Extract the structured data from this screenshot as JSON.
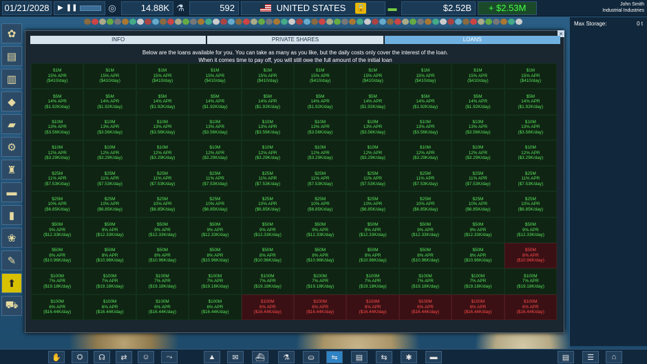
{
  "topbar": {
    "date": "01/21/2028",
    "population": "14.88K",
    "research": "592",
    "country": "UNITED STATES",
    "money": "$2.52B",
    "income": "+ $2.53M",
    "user_name": "John Smith",
    "company": "Industrial Industries"
  },
  "right_panel": {
    "label": "Max Storage:",
    "value": "0 t"
  },
  "modal": {
    "tabs": [
      {
        "label": "INFO",
        "active": false
      },
      {
        "label": "PRIVATE SHARES",
        "active": false
      },
      {
        "label": "LOANS",
        "active": true
      }
    ],
    "intro_line1": "Below are the loans available for you. You can take as many as you like, but the daily costs only cover the interest of the loan.",
    "intro_line2": "When it comes time to pay off, you will still owe the full amount of the initial loan",
    "close_label": "×"
  },
  "loan_rows": [
    {
      "amount": "$1M",
      "apr": "15% APR",
      "daily": "($410/day)",
      "unavailable_from": 10
    },
    {
      "amount": "$5M",
      "apr": "14% APR",
      "daily": "($1.92K/day)",
      "unavailable_from": 10
    },
    {
      "amount": "$10M",
      "apr": "13% APR",
      "daily": "($3.56K/day)",
      "unavailable_from": 10
    },
    {
      "amount": "$10M",
      "apr": "12% APR",
      "daily": "($3.29K/day)",
      "unavailable_from": 10
    },
    {
      "amount": "$25M",
      "apr": "11% APR",
      "daily": "($7.53K/day)",
      "unavailable_from": 10
    },
    {
      "amount": "$25M",
      "apr": "10% APR",
      "daily": "($6.85K/day)",
      "unavailable_from": 10
    },
    {
      "amount": "$50M",
      "apr": "9% APR",
      "daily": "($12.33K/day)",
      "unavailable_from": 10
    },
    {
      "amount": "$50M",
      "apr": "8% APR",
      "daily": "($10.96K/day)",
      "unavailable_from": 9
    },
    {
      "amount": "$100M",
      "apr": "7% APR",
      "daily": "($19.18K/day)",
      "unavailable_from": 10
    },
    {
      "amount": "$100M",
      "apr": "6% APR",
      "daily": "($16.44K/day)",
      "unavailable_from": 4
    }
  ],
  "sidebar_icons": [
    "farm-icon",
    "factory-icon",
    "warehouse-icon",
    "mine-icon",
    "oil-icon",
    "gears-icon",
    "tower-icon",
    "truck-icon",
    "silo-icon",
    "crops-icon",
    "dropper-icon",
    "upgrade-arrow-icon",
    "bulldozer-icon"
  ],
  "bottombar_icons": [
    "vote-icon",
    "bank-icon",
    "megaphone-icon",
    "trade-icon",
    "astronaut-icon",
    "route-icon",
    "people-icon",
    "chat-icon",
    "ship-icon",
    "research-icon",
    "basket-icon",
    "loan-icon",
    "clipboard-icon",
    "transfer-icon",
    "settings-icon",
    "book-icon",
    "library-icon",
    "list-icon",
    "home-icon"
  ]
}
